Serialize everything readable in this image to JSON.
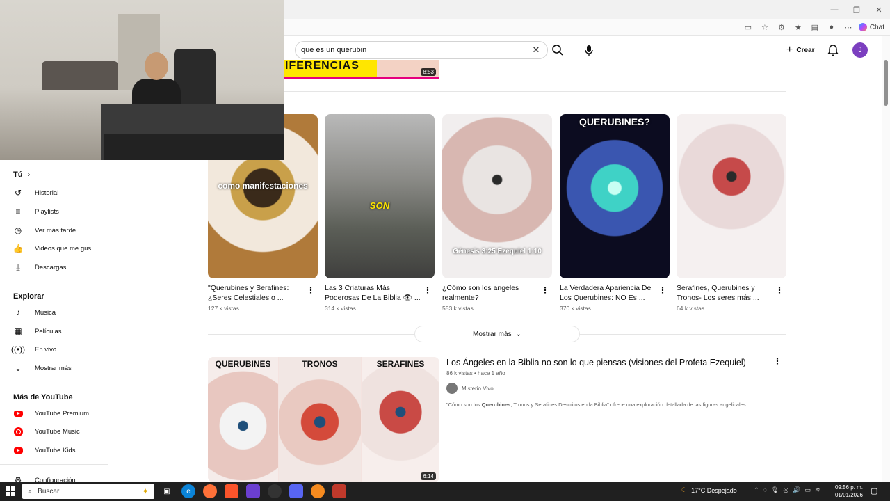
{
  "browser": {
    "window_controls": [
      "—",
      "❐",
      "✕"
    ],
    "chat_label": "Chat"
  },
  "header": {
    "search_value": "que es un querubin",
    "create_label": "Crear",
    "avatar_initial": "J"
  },
  "top_result": {
    "thumb_text": "IFERENCIAS",
    "duration": "8:53"
  },
  "sidebar": {
    "you_label": "Tú",
    "you_items": [
      {
        "label": "Historial",
        "icon": "history-icon"
      },
      {
        "label": "Playlists",
        "icon": "playlist-icon"
      },
      {
        "label": "Ver más tarde",
        "icon": "clock-icon"
      },
      {
        "label": "Videos que me gus...",
        "icon": "thumbs-up-icon"
      },
      {
        "label": "Descargas",
        "icon": "download-icon"
      }
    ],
    "explore_label": "Explorar",
    "explore_items": [
      {
        "label": "Música",
        "icon": "music-icon"
      },
      {
        "label": "Películas",
        "icon": "film-icon"
      },
      {
        "label": "En vivo",
        "icon": "live-icon"
      },
      {
        "label": "Mostrar más",
        "icon": "chevron-down-icon"
      }
    ],
    "more_label": "Más de YouTube",
    "more_items": [
      {
        "label": "YouTube Premium",
        "icon": "youtube-premium-icon"
      },
      {
        "label": "YouTube Music",
        "icon": "youtube-music-icon"
      },
      {
        "label": "YouTube Kids",
        "icon": "youtube-kids-icon"
      }
    ],
    "settings_label": "Configuración"
  },
  "shorts": [
    {
      "title": "\"Querubines y Serafines: ¿Seres Celestiales o ...",
      "views": "127 k vistas",
      "overlay": "como manifestaciones"
    },
    {
      "title": "Las 3 Criaturas Más Poderosas De La Biblia 👁 ...",
      "views": "314 k vistas",
      "overlay": "SON"
    },
    {
      "title": "¿Cómo son los angeles realmente?",
      "views": "553 k vistas",
      "overlay": "Génesis 3:25 Ezequiel 1:10"
    },
    {
      "title": "La Verdadera Apariencia De Los Querubines: NO Es ...",
      "views": "370 k vistas",
      "overlay": "QUERUBINES?"
    },
    {
      "title": "Serafines, Querubines y Tronos- Los seres más ...",
      "views": "64 k vistas",
      "overlay": ""
    }
  ],
  "show_more_label": "Mostrar más",
  "video": {
    "panel_labels": [
      "QUERUBINES",
      "TRONOS",
      "SERAFINES"
    ],
    "duration": "6:14",
    "title": "Los Ángeles en la Biblia no son lo que piensas (visiones del Profeta Ezequiel)",
    "meta": "86 k vistas • hace 1 año",
    "channel": "Misterio Vivo",
    "description_pre": "\"Cómo son los ",
    "description_b1": "Querubines",
    "description_mid": ", Tronos y Serafines Descritos en la Biblia\" ofrece una exploración detallada de las figuras angelicales ..."
  },
  "taskbar": {
    "search_placeholder": "Buscar",
    "weather": "17°C  Despejado",
    "time": "09:56 p. m.",
    "date": "01/01/2026"
  }
}
